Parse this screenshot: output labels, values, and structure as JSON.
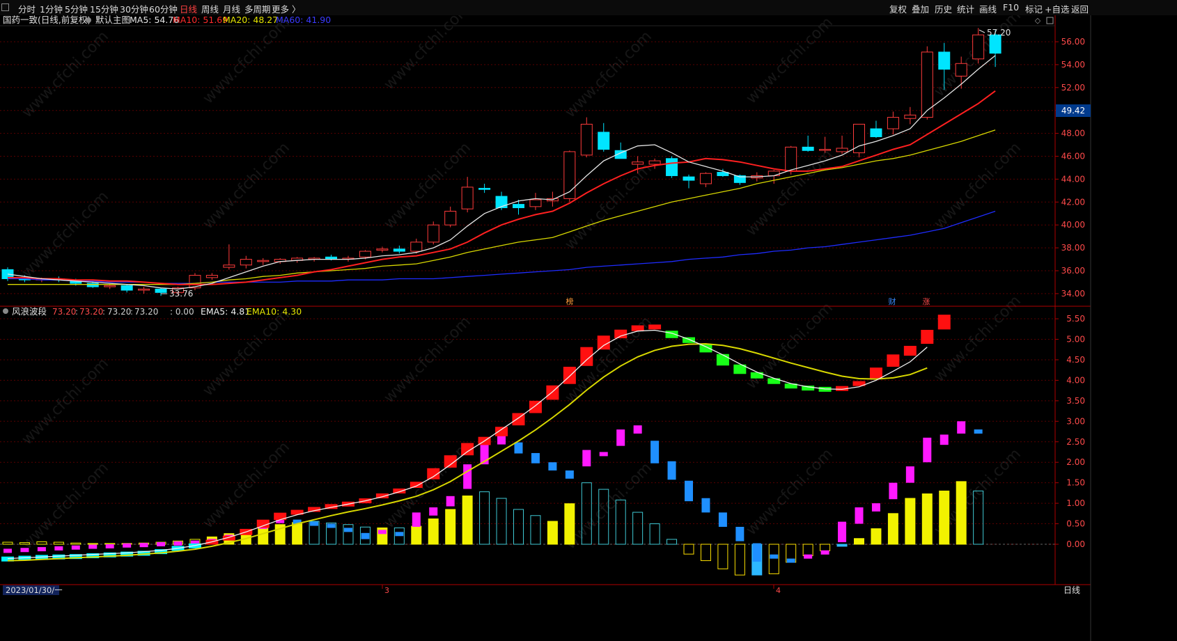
{
  "toolbar": {
    "periods": [
      "分时",
      "1分钟",
      "5分钟",
      "15分钟",
      "30分钟",
      "60分钟",
      "日线",
      "周线",
      "月线",
      "多周期",
      "更多 〉"
    ],
    "active_index": 6,
    "right": [
      "复权",
      "叠加",
      "历史",
      "统计",
      "画线",
      "F10",
      "标记",
      "+自选",
      "返回"
    ]
  },
  "main_panel": {
    "title": "国药一致(日线,前复权)",
    "sub": "默认主图",
    "ma_legend": [
      {
        "label": "MA5: 54.76",
        "color": "#e6e6e6"
      },
      {
        "label": "MA10: 51.69",
        "color": "#ff2b2b"
      },
      {
        "label": "MA20: 48.27",
        "color": "#e6e600"
      },
      {
        "label": "MA60: 41.90",
        "color": "#2a2aff"
      }
    ],
    "price_ticks": [
      "56.00",
      "54.00",
      "52.00",
      "50.00",
      "48.00",
      "46.00",
      "44.00",
      "42.00",
      "40.00",
      "38.00",
      "36.00",
      "34.00"
    ],
    "current_price": "49.42",
    "high_label": "57.20",
    "low_label": "33.76",
    "markers": [
      "榜",
      "财",
      "涨"
    ]
  },
  "indicator_panel": {
    "name": "风浪波段",
    "values": [
      "73.20",
      "73.20",
      "73.20",
      "73.20"
    ],
    "zero": ": 0.00",
    "ema5": "EMA5: 4.81",
    "ema10": "EMA10: 4.30",
    "ticks": [
      "5.50",
      "5.00",
      "4.50",
      "4.00",
      "3.50",
      "3.00",
      "2.50",
      "2.00",
      "1.50",
      "1.00",
      "0.50",
      "0.00"
    ]
  },
  "bottom": {
    "date": "2023/01/30/一",
    "month_labels": [
      "3",
      "4"
    ],
    "period": "日线"
  },
  "watermark": "www.cfchi.com",
  "colors": {
    "up": "#ff3b3b",
    "down": "#00e5ff",
    "ma5": "#e6e6e6",
    "ma10": "#ff2020",
    "ma20": "#d8d800",
    "ma60": "#1e2cff",
    "grid": "#5a0000",
    "axis": "#b00000"
  },
  "chart_data": {
    "type": "candlestick",
    "candles": [
      {
        "o": 36.1,
        "h": 36.3,
        "l": 35.1,
        "c": 35.3
      },
      {
        "o": 35.3,
        "h": 35.6,
        "l": 35.0,
        "c": 35.2
      },
      {
        "o": 35.2,
        "h": 35.4,
        "l": 35.0,
        "c": 35.3
      },
      {
        "o": 35.3,
        "h": 35.5,
        "l": 35.0,
        "c": 35.2
      },
      {
        "o": 35.2,
        "h": 35.3,
        "l": 34.7,
        "c": 34.9
      },
      {
        "o": 34.9,
        "h": 35.1,
        "l": 34.5,
        "c": 34.6
      },
      {
        "o": 34.6,
        "h": 34.8,
        "l": 34.4,
        "c": 34.7
      },
      {
        "o": 34.7,
        "h": 34.8,
        "l": 34.1,
        "c": 34.3
      },
      {
        "o": 34.3,
        "h": 34.6,
        "l": 34.0,
        "c": 34.4
      },
      {
        "o": 34.4,
        "h": 34.5,
        "l": 33.8,
        "c": 34.1
      },
      {
        "o": 34.1,
        "h": 34.6,
        "l": 33.9,
        "c": 34.5
      },
      {
        "o": 34.5,
        "h": 35.8,
        "l": 34.3,
        "c": 35.6
      },
      {
        "o": 35.4,
        "h": 35.8,
        "l": 35.2,
        "c": 35.6
      },
      {
        "o": 36.3,
        "h": 38.3,
        "l": 36.1,
        "c": 36.5
      },
      {
        "o": 36.5,
        "h": 37.3,
        "l": 36.2,
        "c": 37.0
      },
      {
        "o": 36.8,
        "h": 37.1,
        "l": 36.5,
        "c": 36.9
      },
      {
        "o": 36.8,
        "h": 37.1,
        "l": 36.6,
        "c": 37.0
      },
      {
        "o": 36.9,
        "h": 37.2,
        "l": 36.7,
        "c": 37.1
      },
      {
        "o": 37.0,
        "h": 37.2,
        "l": 36.8,
        "c": 37.1
      },
      {
        "o": 37.2,
        "h": 37.4,
        "l": 36.9,
        "c": 37.0
      },
      {
        "o": 37.1,
        "h": 37.3,
        "l": 36.8,
        "c": 37.1
      },
      {
        "o": 37.2,
        "h": 37.8,
        "l": 37.0,
        "c": 37.7
      },
      {
        "o": 37.8,
        "h": 38.1,
        "l": 37.6,
        "c": 37.9
      },
      {
        "o": 37.9,
        "h": 38.2,
        "l": 37.5,
        "c": 37.7
      },
      {
        "o": 37.7,
        "h": 38.8,
        "l": 37.5,
        "c": 38.5
      },
      {
        "o": 38.5,
        "h": 40.3,
        "l": 38.3,
        "c": 40.0
      },
      {
        "o": 40.0,
        "h": 41.6,
        "l": 39.8,
        "c": 41.2
      },
      {
        "o": 41.4,
        "h": 44.2,
        "l": 41.1,
        "c": 43.3
      },
      {
        "o": 43.2,
        "h": 43.6,
        "l": 42.8,
        "c": 43.1
      },
      {
        "o": 42.5,
        "h": 42.9,
        "l": 41.3,
        "c": 41.5
      },
      {
        "o": 41.8,
        "h": 42.2,
        "l": 40.9,
        "c": 41.5
      },
      {
        "o": 41.6,
        "h": 42.8,
        "l": 41.3,
        "c": 42.2
      },
      {
        "o": 42.1,
        "h": 42.9,
        "l": 41.6,
        "c": 42.3
      },
      {
        "o": 42.3,
        "h": 46.5,
        "l": 42.0,
        "c": 46.4
      },
      {
        "o": 46.1,
        "h": 49.4,
        "l": 45.9,
        "c": 48.8
      },
      {
        "o": 48.1,
        "h": 48.9,
        "l": 46.4,
        "c": 46.6
      },
      {
        "o": 46.5,
        "h": 47.2,
        "l": 45.8,
        "c": 45.8
      },
      {
        "o": 45.3,
        "h": 46.0,
        "l": 44.5,
        "c": 45.5
      },
      {
        "o": 45.3,
        "h": 45.8,
        "l": 44.9,
        "c": 45.6
      },
      {
        "o": 45.8,
        "h": 46.0,
        "l": 44.1,
        "c": 44.3
      },
      {
        "o": 44.2,
        "h": 44.4,
        "l": 43.2,
        "c": 43.9
      },
      {
        "o": 43.6,
        "h": 44.6,
        "l": 43.3,
        "c": 44.5
      },
      {
        "o": 44.6,
        "h": 44.9,
        "l": 44.2,
        "c": 44.3
      },
      {
        "o": 44.3,
        "h": 44.4,
        "l": 43.5,
        "c": 43.7
      },
      {
        "o": 44.1,
        "h": 44.6,
        "l": 43.8,
        "c": 44.3
      },
      {
        "o": 44.3,
        "h": 44.8,
        "l": 43.6,
        "c": 44.7
      },
      {
        "o": 44.7,
        "h": 46.9,
        "l": 44.4,
        "c": 46.8
      },
      {
        "o": 46.8,
        "h": 47.8,
        "l": 46.4,
        "c": 46.5
      },
      {
        "o": 46.6,
        "h": 47.7,
        "l": 46.3,
        "c": 46.6
      },
      {
        "o": 46.4,
        "h": 47.8,
        "l": 46.2,
        "c": 46.7
      },
      {
        "o": 46.3,
        "h": 48.8,
        "l": 45.9,
        "c": 48.8
      },
      {
        "o": 48.4,
        "h": 49.1,
        "l": 47.6,
        "c": 47.7
      },
      {
        "o": 48.4,
        "h": 49.9,
        "l": 47.9,
        "c": 49.4
      },
      {
        "o": 49.3,
        "h": 50.3,
        "l": 48.8,
        "c": 49.6
      },
      {
        "o": 49.4,
        "h": 55.6,
        "l": 49.2,
        "c": 55.1
      },
      {
        "o": 55.1,
        "h": 55.9,
        "l": 51.8,
        "c": 53.6
      },
      {
        "o": 53.0,
        "h": 54.7,
        "l": 51.9,
        "c": 54.1
      },
      {
        "o": 54.5,
        "h": 57.2,
        "l": 54.1,
        "c": 56.6
      },
      {
        "o": 56.6,
        "h": 57.0,
        "l": 53.8,
        "c": 55.0
      }
    ],
    "ma5": [
      35.7,
      35.5,
      35.3,
      35.2,
      35.1,
      35.0,
      34.9,
      34.8,
      34.7,
      34.5,
      34.4,
      34.6,
      34.9,
      35.4,
      35.9,
      36.4,
      36.8,
      36.9,
      37.0,
      37.0,
      37.0,
      37.1,
      37.3,
      37.4,
      37.6,
      38.0,
      38.7,
      39.9,
      41.0,
      41.6,
      42.1,
      42.3,
      42.2,
      42.9,
      44.3,
      45.6,
      46.3,
      46.9,
      47.0,
      46.3,
      45.5,
      45.1,
      44.7,
      44.2,
      44.2,
      44.3,
      44.8,
      45.2,
      45.6,
      46.1,
      46.9,
      47.3,
      47.8,
      48.4,
      50.0,
      51.1,
      52.3,
      53.6,
      54.8
    ],
    "ma10": [
      35.4,
      35.4,
      35.3,
      35.3,
      35.2,
      35.2,
      35.1,
      35.1,
      35.0,
      34.9,
      34.8,
      34.8,
      34.8,
      34.9,
      35.0,
      35.2,
      35.4,
      35.6,
      35.9,
      36.1,
      36.4,
      36.7,
      37.0,
      37.2,
      37.3,
      37.6,
      37.9,
      38.5,
      39.3,
      40.0,
      40.5,
      40.9,
      41.2,
      41.9,
      42.8,
      43.6,
      44.3,
      44.9,
      45.2,
      45.4,
      45.5,
      45.8,
      45.7,
      45.5,
      45.2,
      44.9,
      44.7,
      44.7,
      44.9,
      45.1,
      45.6,
      46.1,
      46.6,
      47.0,
      47.9,
      48.8,
      49.7,
      50.6,
      51.7
    ],
    "ma20": [
      34.8,
      34.8,
      34.8,
      34.8,
      34.8,
      34.8,
      34.8,
      34.8,
      34.8,
      34.8,
      34.8,
      34.9,
      35.0,
      35.2,
      35.3,
      35.5,
      35.6,
      35.8,
      35.9,
      36.0,
      36.1,
      36.2,
      36.4,
      36.5,
      36.6,
      36.9,
      37.2,
      37.6,
      37.9,
      38.2,
      38.5,
      38.7,
      38.9,
      39.4,
      39.9,
      40.4,
      40.8,
      41.2,
      41.6,
      42.0,
      42.3,
      42.6,
      42.9,
      43.2,
      43.6,
      43.9,
      44.2,
      44.5,
      44.8,
      45.0,
      45.3,
      45.6,
      45.8,
      46.1,
      46.5,
      46.9,
      47.3,
      47.8,
      48.3
    ],
    "ma60": [
      35.3,
      35.3,
      35.2,
      35.2,
      35.1,
      35.1,
      35.0,
      35.0,
      35.0,
      34.9,
      34.9,
      34.9,
      35.0,
      35.0,
      35.0,
      35.0,
      35.0,
      35.1,
      35.1,
      35.1,
      35.2,
      35.2,
      35.2,
      35.3,
      35.3,
      35.3,
      35.4,
      35.5,
      35.6,
      35.7,
      35.8,
      35.9,
      36.0,
      36.1,
      36.3,
      36.4,
      36.5,
      36.6,
      36.7,
      36.8,
      37.0,
      37.1,
      37.2,
      37.4,
      37.5,
      37.7,
      37.8,
      38.0,
      38.1,
      38.3,
      38.5,
      38.7,
      38.9,
      39.1,
      39.4,
      39.7,
      40.2,
      40.7,
      41.2
    ],
    "indicator": {
      "wave_blocks": [
        -0.36,
        -0.34,
        -0.32,
        -0.31,
        -0.3,
        -0.28,
        -0.26,
        -0.24,
        -0.22,
        -0.18,
        -0.1,
        -0.04,
        0.05,
        0.15,
        0.3,
        0.5,
        0.68,
        0.78,
        0.85,
        0.92,
        0.98,
        1.06,
        1.18,
        1.3,
        1.45,
        1.72,
        2.02,
        2.32,
        2.52,
        2.75,
        3.05,
        3.35,
        3.7,
        4.12,
        4.58,
        4.92,
        5.13,
        5.27,
        5.3,
        5.12,
        4.98,
        4.78,
        4.5,
        4.27,
        4.12,
        3.98,
        3.86,
        3.81,
        3.78,
        3.8,
        3.92,
        4.18,
        4.48,
        4.72,
        5.06,
        5.42
      ],
      "wave_dir": [
        "d",
        "d",
        "d",
        "d",
        "d",
        "d",
        "d",
        "d",
        "d",
        "d",
        "d",
        "d",
        "u",
        "u",
        "u",
        "u",
        "u",
        "u",
        "u",
        "u",
        "u",
        "u",
        "u",
        "u",
        "u",
        "u",
        "u",
        "u",
        "u",
        "u",
        "u",
        "u",
        "u",
        "u",
        "u",
        "u",
        "u",
        "u",
        "u",
        "d",
        "d",
        "d",
        "d",
        "d",
        "d",
        "d",
        "d",
        "d",
        "d",
        "u",
        "u",
        "u",
        "u",
        "u",
        "u",
        "u"
      ],
      "hist_yellow": [
        0.05,
        0.04,
        0.06,
        0.05,
        0.03,
        0.02,
        0.02,
        0.02,
        0.03,
        0.05,
        0.08,
        0.12,
        0.18,
        0.26,
        0.34,
        0.4,
        0.48,
        0.53,
        0.56,
        0.52,
        0.48,
        0.42,
        0.4,
        0.4,
        0.44,
        0.62,
        0.85,
        1.18,
        1.28,
        1.12,
        0.85,
        0.7,
        0.56,
        0.99,
        1.5,
        1.34,
        1.08,
        0.78,
        0.5,
        0.12,
        -0.24,
        -0.4,
        -0.6,
        -0.75,
        -0.75,
        -0.72,
        -0.44,
        -0.28,
        -0.16,
        -0.05,
        0.14,
        0.38,
        0.75,
        1.12,
        1.23,
        1.3,
        1.53,
        1.3
      ],
      "hist_filled": [
        true,
        true,
        true,
        true,
        true,
        true,
        true,
        true,
        true,
        true,
        true,
        true,
        true,
        true,
        true,
        true,
        true,
        true,
        false,
        false,
        false,
        false,
        true,
        false,
        true,
        true,
        true,
        true,
        false,
        false,
        false,
        false,
        true,
        true,
        false,
        false,
        false,
        false,
        false,
        false,
        false,
        false,
        false,
        false,
        true,
        false,
        false,
        false,
        false,
        true,
        true,
        true,
        true,
        true,
        true,
        true,
        true,
        false
      ],
      "magenta": [
        -0.16,
        -0.14,
        -0.12,
        -0.1,
        -0.08,
        -0.06,
        -0.05,
        -0.03,
        -0.02,
        0.0,
        0.02,
        0.04,
        0.08,
        0.18,
        0.3,
        0.45,
        0.58,
        0.55,
        0.5,
        0.45,
        0.35,
        0.2,
        0.3,
        0.25,
        0.6,
        0.8,
        1.05,
        1.65,
        2.25,
        2.62,
        2.35,
        2.1,
        1.9,
        1.7,
        2.1,
        2.2,
        2.6,
        2.8,
        2.25,
        1.8,
        1.3,
        0.95,
        0.6,
        0.25,
        -0.2,
        -0.3,
        -0.4,
        -0.3,
        -0.2,
        0.3,
        0.7,
        0.9,
        1.3,
        1.7,
        2.3,
        2.55,
        2.85,
        2.75
      ],
      "ema5": [
        -0.35,
        -0.33,
        -0.31,
        -0.29,
        -0.27,
        -0.25,
        -0.23,
        -0.21,
        -0.18,
        -0.15,
        -0.1,
        -0.03,
        0.06,
        0.17,
        0.3,
        0.45,
        0.6,
        0.72,
        0.82,
        0.9,
        0.98,
        1.06,
        1.16,
        1.28,
        1.42,
        1.65,
        1.94,
        2.26,
        2.52,
        2.8,
        3.08,
        3.38,
        3.72,
        4.1,
        4.5,
        4.85,
        5.08,
        5.2,
        5.22,
        5.15,
        5.0,
        4.82,
        4.62,
        4.4,
        4.2,
        4.05,
        3.92,
        3.84,
        3.79,
        3.78,
        3.84,
        4.0,
        4.22,
        4.45,
        4.81
      ],
      "ema10": [
        -0.4,
        -0.39,
        -0.37,
        -0.35,
        -0.33,
        -0.31,
        -0.29,
        -0.27,
        -0.24,
        -0.21,
        -0.17,
        -0.12,
        -0.05,
        0.04,
        0.14,
        0.26,
        0.38,
        0.5,
        0.6,
        0.7,
        0.79,
        0.87,
        0.96,
        1.06,
        1.17,
        1.33,
        1.53,
        1.78,
        2.02,
        2.27,
        2.52,
        2.79,
        3.09,
        3.41,
        3.76,
        4.08,
        4.35,
        4.57,
        4.73,
        4.83,
        4.88,
        4.89,
        4.85,
        4.77,
        4.66,
        4.54,
        4.42,
        4.31,
        4.2,
        4.1,
        4.04,
        4.03,
        4.06,
        4.14,
        4.3
      ]
    }
  }
}
